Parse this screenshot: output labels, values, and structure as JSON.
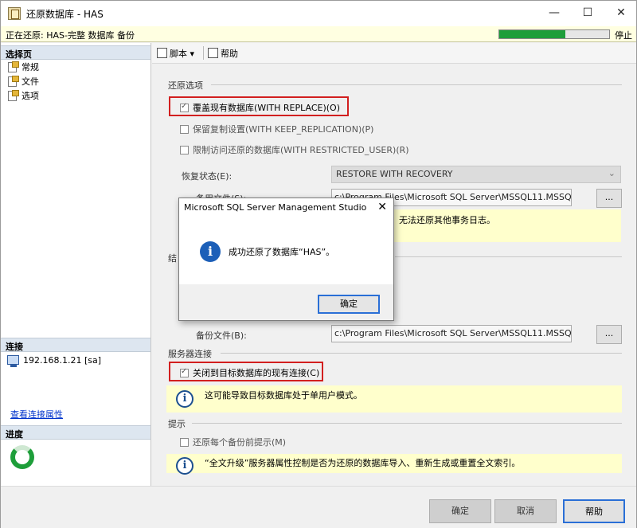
{
  "window": {
    "title": "还原数据库 - HAS",
    "controls": {
      "minimize": "—",
      "maximize": "☐",
      "close": "✕"
    }
  },
  "status": {
    "text": "正在还原: HAS-完整 数据库 备份",
    "progress_fraction": 0.6,
    "stop_label": "停止"
  },
  "left_panel": {
    "select_page_header": "选择页",
    "pages": [
      "常规",
      "文件",
      "选项"
    ],
    "connection_header": "连接",
    "connection": "192.168.1.21 [sa]",
    "view_connection_link": "查看连接属性",
    "progress_header": "进度"
  },
  "toolbar": {
    "script_label": "脚本",
    "help_label": "帮助"
  },
  "restore_options": {
    "group_label": "还原选项",
    "options": [
      {
        "label": "覆盖现有数据库(WITH REPLACE)(O)",
        "checked": true
      },
      {
        "label": "保留复制设置(WITH KEEP_REPLICATION)(P)",
        "checked": false
      },
      {
        "label": "限制访问还原的数据库(WITH RESTRICTED_USER)(R)",
        "checked": false
      }
    ],
    "recovery_state_label": "恢复状态(E):",
    "recovery_state_value": "RESTORE WITH RECOVERY",
    "standby_file_label": "备用文件(S):",
    "standby_file_value": "c:\\Program Files\\Microsoft SQL Server\\MSSQL11.MSSQ",
    "info_text": "无法还原其他事务日志。",
    "tail_group_partial": "结",
    "backup_file_label": "备份文件(B):",
    "backup_file_value": "c:\\Program Files\\Microsoft SQL Server\\MSSQL11.MSSQ",
    "browse_label": "..."
  },
  "server_connection": {
    "group_label": "服务器连接",
    "close_connections_label": "关闭到目标数据库的现有连接(C)",
    "close_connections_checked": true,
    "info_text": "这可能导致目标数据库处于单用户模式。"
  },
  "prompt": {
    "group_label": "提示",
    "prompt_before_label": "还原每个备份前提示(M)",
    "prompt_before_checked": false,
    "info_text": "“全文升级”服务器属性控制是否为还原的数据库导入、重新生成或重置全文索引。"
  },
  "footer": {
    "ok_label": "确定",
    "cancel_label": "取消",
    "help_label": "帮助"
  },
  "dialog": {
    "title": "Microsoft SQL Server Management Studio",
    "message": "成功还原了数据库“HAS”。",
    "ok_label": "确定",
    "close_glyph": "✕",
    "icon_glyph": "i"
  },
  "colors": {
    "progress_green": "#1e9e3a",
    "highlight_red": "#d21f1f",
    "info_yellow": "#ffffcc",
    "accent_blue": "#2a6fd6"
  }
}
